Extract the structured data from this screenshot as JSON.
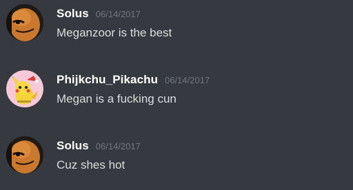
{
  "messages": [
    {
      "author": "Solus",
      "timestamp": "06/14/2017",
      "text": "Meganzoor is the best",
      "avatar_icon": "charmander-avatar-icon"
    },
    {
      "author": "Phijkchu_Pikachu",
      "timestamp": "06/14/2017",
      "text": "Megan is a fucking cun",
      "avatar_icon": "pikachu-avatar-icon"
    },
    {
      "author": "Solus",
      "timestamp": "06/14/2017",
      "text": "Cuz shes hot",
      "avatar_icon": "charmander-avatar-icon"
    }
  ],
  "colors": {
    "background": "#36393f",
    "username": "#ffffff",
    "timestamp": "#72767d",
    "message_text": "#dcddde"
  }
}
